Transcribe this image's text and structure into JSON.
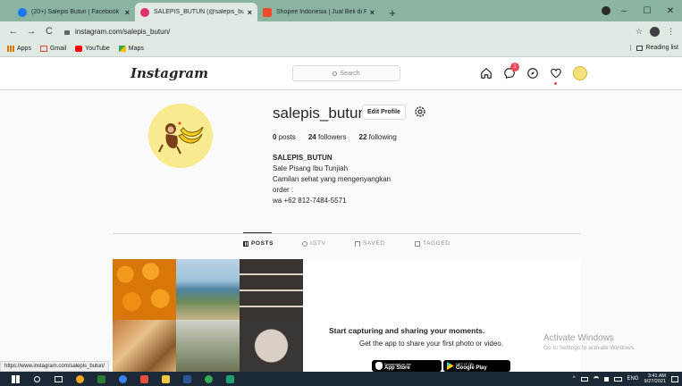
{
  "browser": {
    "tabs": [
      {
        "title": "(20+) Salepis Butun | Facebook",
        "favicon_color": "#1877f2",
        "active": false
      },
      {
        "title": "SALEPIS_BUTUN (@salepis_butu",
        "favicon_color": "#e1306c",
        "active": true
      },
      {
        "title": "Shopee Indonesia | Jual Beli di P",
        "favicon_color": "#ee4d2d",
        "active": false
      }
    ],
    "close_glyph": "×",
    "new_tab_glyph": "+",
    "window_controls": [
      "–",
      "☐",
      "✕"
    ],
    "nav": {
      "back": "←",
      "forward": "→",
      "reload": "C"
    },
    "url": "instagram.com/salepis_butun/",
    "star_glyph": "☆",
    "menu_glyph": "⋮",
    "bookmarks": [
      {
        "label": "Apps",
        "color": "#e37400"
      },
      {
        "label": "Gmail",
        "color": "#ea4335"
      },
      {
        "label": "YouTube",
        "color": "#ff0000"
      },
      {
        "label": "Maps",
        "color": "#34a853"
      }
    ],
    "reading_list": "Reading list",
    "status_url": "https://www.instagram.com/salepis_butun/"
  },
  "instagram": {
    "logo": "Instagram",
    "search_placeholder": "Search",
    "notification_count": "1",
    "profile": {
      "username": "salepis_butun",
      "edit_label": "Edit Profile",
      "posts_count": "0",
      "posts_label": "posts",
      "followers_count": "24",
      "followers_label": "followers",
      "following_count": "22",
      "following_label": "following",
      "bio_name": "SALEPIS_BUTUN",
      "bio_lines": [
        "Sale Pisang Ibu Tunjiah",
        "Camilan sehat yang mengenyangkan",
        "order :",
        "wa +62 812-7484-5571"
      ]
    },
    "tabs": [
      "POSTS",
      "IGTV",
      "SAVED",
      "TAGGED"
    ],
    "empty_title": "Start capturing and sharing your moments.",
    "empty_subtitle": "Get the app to share your first photo or video.",
    "app_store": {
      "line1": "Download on the",
      "line2": "App Store"
    },
    "google_play": {
      "line1": "GET IT ON",
      "line2": "Google Play"
    }
  },
  "windows": {
    "activate_title": "Activate Windows",
    "activate_sub": "Go to Settings to activate Windows.",
    "time": "3:41 AM",
    "date": "9/27/2021",
    "lang": "ENG",
    "taskbar_colors": [
      "#ffffff",
      "#ffffff",
      "#ffffff",
      "#f5a623",
      "#2e7d32",
      "#3b82f6",
      "#e74c3c",
      "#f5c542",
      "#2b5797",
      "#34a853",
      "#1f9e6e"
    ]
  }
}
